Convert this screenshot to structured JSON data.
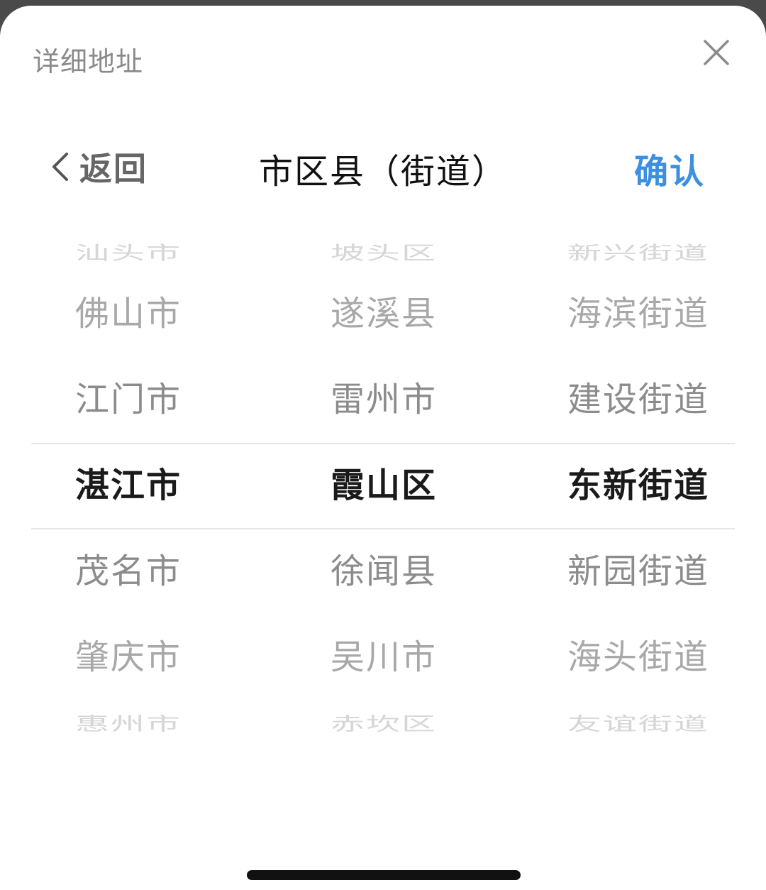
{
  "sheet": {
    "title": "详细地址",
    "close_icon": "close-icon"
  },
  "nav": {
    "back_label": "返回",
    "back_icon": "chevron-left-icon",
    "title": "市区县（街道）",
    "confirm_label": "确认",
    "confirm_color": "#3d8fe0"
  },
  "picker": {
    "columns": [
      {
        "name": "city",
        "items": [
          "汕头市",
          "佛山市",
          "江门市",
          "湛江市",
          "茂名市",
          "肇庆市",
          "惠州市"
        ],
        "selected": "湛江市"
      },
      {
        "name": "district",
        "items": [
          "坡头区",
          "遂溪县",
          "雷州市",
          "霞山区",
          "徐闻县",
          "吴川市",
          "赤坎区"
        ],
        "selected": "霞山区"
      },
      {
        "name": "street",
        "items": [
          "新兴街道",
          "海滨街道",
          "建设街道",
          "东新街道",
          "新园街道",
          "海头街道",
          "友谊街道"
        ],
        "selected": "东新街道"
      }
    ]
  }
}
